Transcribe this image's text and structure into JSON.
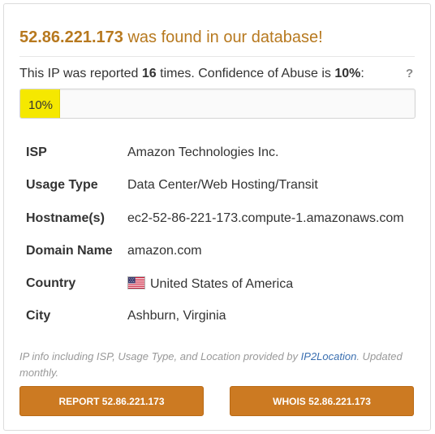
{
  "header": {
    "ip": "52.86.221.173",
    "found_text": " was found in our database!"
  },
  "report": {
    "prefix": "This IP was reported ",
    "count": "16",
    "middle": " times. Confidence of Abuse is ",
    "confidence": "10%",
    "suffix": ":",
    "help_label": "?"
  },
  "progress": {
    "label": "10%",
    "fraction": 0.1,
    "fill_color": "#f5e800"
  },
  "details": [
    {
      "label": "ISP",
      "value": "Amazon Technologies Inc."
    },
    {
      "label": "Usage Type",
      "value": "Data Center/Web Hosting/Transit"
    },
    {
      "label": "Hostname(s)",
      "value": "ec2-52-86-221-173.compute-1.amazonaws.com"
    },
    {
      "label": "Domain Name",
      "value": "amazon.com"
    },
    {
      "label": "Country",
      "value": "United States of America",
      "icon": "us-flag-icon"
    },
    {
      "label": "City",
      "value": "Ashburn, Virginia"
    }
  ],
  "footnote": {
    "before": "IP info including ISP, Usage Type, and Location provided by ",
    "link_text": "IP2Location",
    "after": ". Updated monthly."
  },
  "buttons": {
    "report_label": "REPORT 52.86.221.173",
    "whois_label": "WHOIS 52.86.221.173"
  },
  "colors": {
    "accent": "#cc7a22",
    "title": "#b7791f",
    "link": "#3a6fb0"
  }
}
